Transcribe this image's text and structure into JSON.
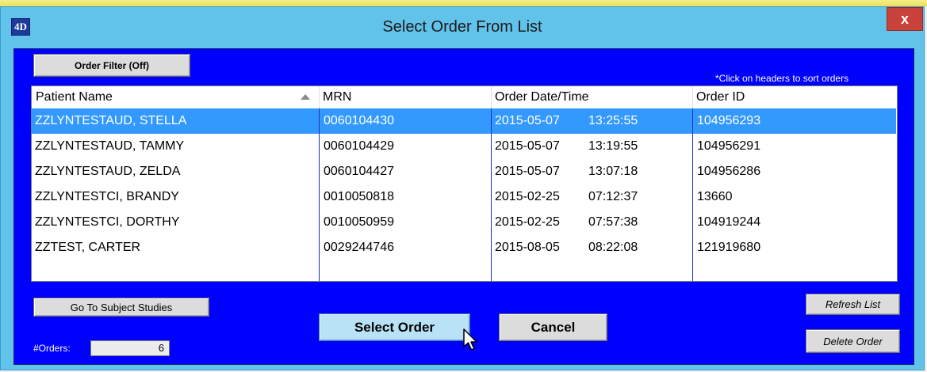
{
  "window": {
    "title": "Select Order From List",
    "app_icon_text": "4D",
    "close_label": "x"
  },
  "toolbar": {
    "order_filter_label": "Order Filter (Off)",
    "sort_hint": "*Click on headers to sort orders"
  },
  "table": {
    "columns": [
      "Patient Name",
      "MRN",
      "Order Date/Time",
      "Order ID"
    ],
    "sorted_column": "Patient Name",
    "sort_direction": "ascending",
    "selected_row": 0,
    "rows": [
      {
        "patient": "ZZLYNTESTAUD, STELLA",
        "mrn": "0060104430",
        "date": "2015-05-07",
        "time": "13:25:55",
        "order_id": "104956293"
      },
      {
        "patient": "ZZLYNTESTAUD, TAMMY",
        "mrn": "0060104429",
        "date": "2015-05-07",
        "time": "13:19:55",
        "order_id": "104956291"
      },
      {
        "patient": "ZZLYNTESTAUD, ZELDA",
        "mrn": "0060104427",
        "date": "2015-05-07",
        "time": "13:07:18",
        "order_id": "104956286"
      },
      {
        "patient": "ZZLYNTESTCI, BRANDY",
        "mrn": "0010050818",
        "date": "2015-02-25",
        "time": "07:12:37",
        "order_id": "13660"
      },
      {
        "patient": "ZZLYNTESTCI, DORTHY",
        "mrn": "0010050959",
        "date": "2015-02-25",
        "time": "07:57:38",
        "order_id": "104919244"
      },
      {
        "patient": "ZZTEST, CARTER",
        "mrn": "0029244746",
        "date": "2015-08-05",
        "time": "08:22:08",
        "order_id": "121919680"
      }
    ]
  },
  "buttons": {
    "go_to_subject_studies": "Go To Subject Studies",
    "select_order": "Select Order",
    "cancel": "Cancel",
    "refresh_list": "Refresh List",
    "delete_order": "Delete Order"
  },
  "footer": {
    "orders_label": "#Orders:",
    "orders_count": "6"
  },
  "colors": {
    "client_background": "#0000fd",
    "title_bar": "#62c3ea",
    "selection": "#3399ff",
    "close_button": "#c8413a"
  },
  "icons": [
    "app-icon",
    "close-icon",
    "sort-ascending-icon",
    "chevron-up-icon",
    "chevron-down-icon",
    "mouse-cursor-icon"
  ]
}
